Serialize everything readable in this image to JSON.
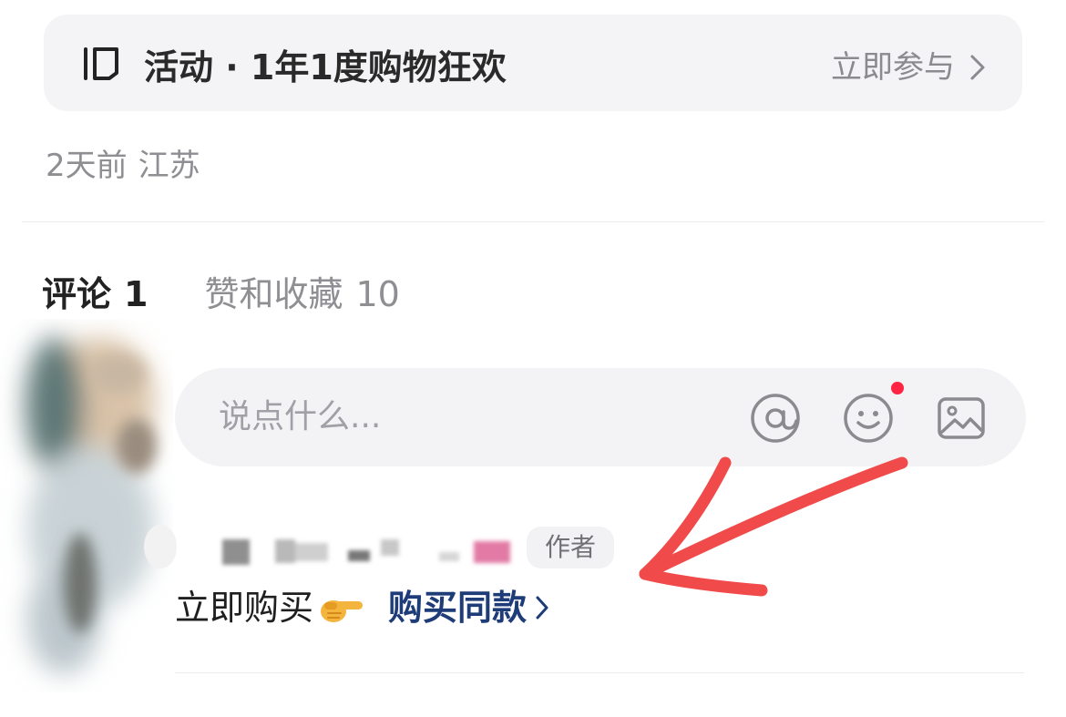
{
  "activity": {
    "icon": "bracket-tag-icon",
    "text": "活动 · 1年1度购物狂欢",
    "action_label": "立即参与",
    "chevron_icon": "chevron-right-icon"
  },
  "post_meta": {
    "time": "2天前",
    "location": "江苏"
  },
  "tabs": [
    {
      "label": "评论",
      "count": "1",
      "active": true
    },
    {
      "label": "赞和收藏",
      "count": "10",
      "active": false
    }
  ],
  "comment_input": {
    "placeholder": "说点什么...",
    "icons": [
      "at-icon",
      "emoji-smile-icon",
      "image-icon"
    ],
    "emoji_has_notification": true,
    "notification_color": "#ff2442"
  },
  "comment": {
    "author_badge": "作者",
    "text": "立即购买",
    "emoji": "hand-pointing-right-icon",
    "link_text": "购买同款",
    "link_color": "#1e3c78"
  },
  "annotation": {
    "type": "red-arrow",
    "color": "#f04a4a",
    "points_to": "buy-same-link"
  }
}
